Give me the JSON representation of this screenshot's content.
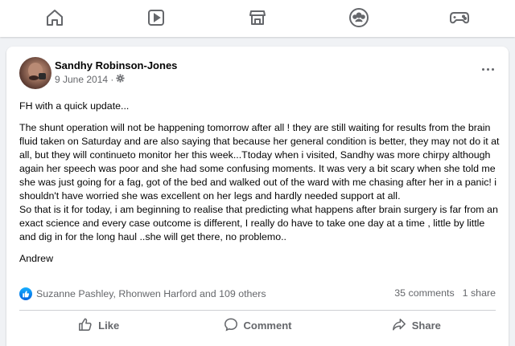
{
  "nav": {
    "items": [
      {
        "name": "home-icon"
      },
      {
        "name": "video-icon"
      },
      {
        "name": "marketplace-icon"
      },
      {
        "name": "groups-icon"
      },
      {
        "name": "gaming-icon"
      }
    ]
  },
  "post": {
    "author": "Sandhy Robinson-Jones",
    "date": "9 June 2014 · ",
    "privacy_icon": "settings-gear-icon",
    "paragraphs": [
      "FH with a quick update...",
      "The shunt operation will not be happening tomorrow after all ! they are still waiting for results from the brain fluid taken on Saturday and are also saying that because her general condition is better, they may not do it at all, but they will continueto  monitor her this week...Ttoday when i visited, Sandhy was more chirpy although again her speech was poor and she had some confusing moments. It was very a bit scary when she told me she was just going for a fag, got of the bed and walked out of the ward with me chasing after her in a panic! i shouldn't have worried she was excellent on her legs and hardly needed support at all.",
      "So that is it for today, i am beginning to realise that predicting what happens after brain surgery is far from an exact science and every case outcome is different, I really do have to take one day at a time , little by little and dig in for the long haul ..she will get there, no problemo..",
      "Andrew"
    ],
    "reactions_text": "Suzanne Pashley, Rhonwen Harford and 109 others",
    "comments_count": "35 comments",
    "shares_count": "1 share"
  },
  "actions": {
    "like": "Like",
    "comment": "Comment",
    "share": "Share"
  },
  "colors": {
    "accent": "#1877f2",
    "secondary_text": "#65676b",
    "background": "#f0f2f5"
  }
}
